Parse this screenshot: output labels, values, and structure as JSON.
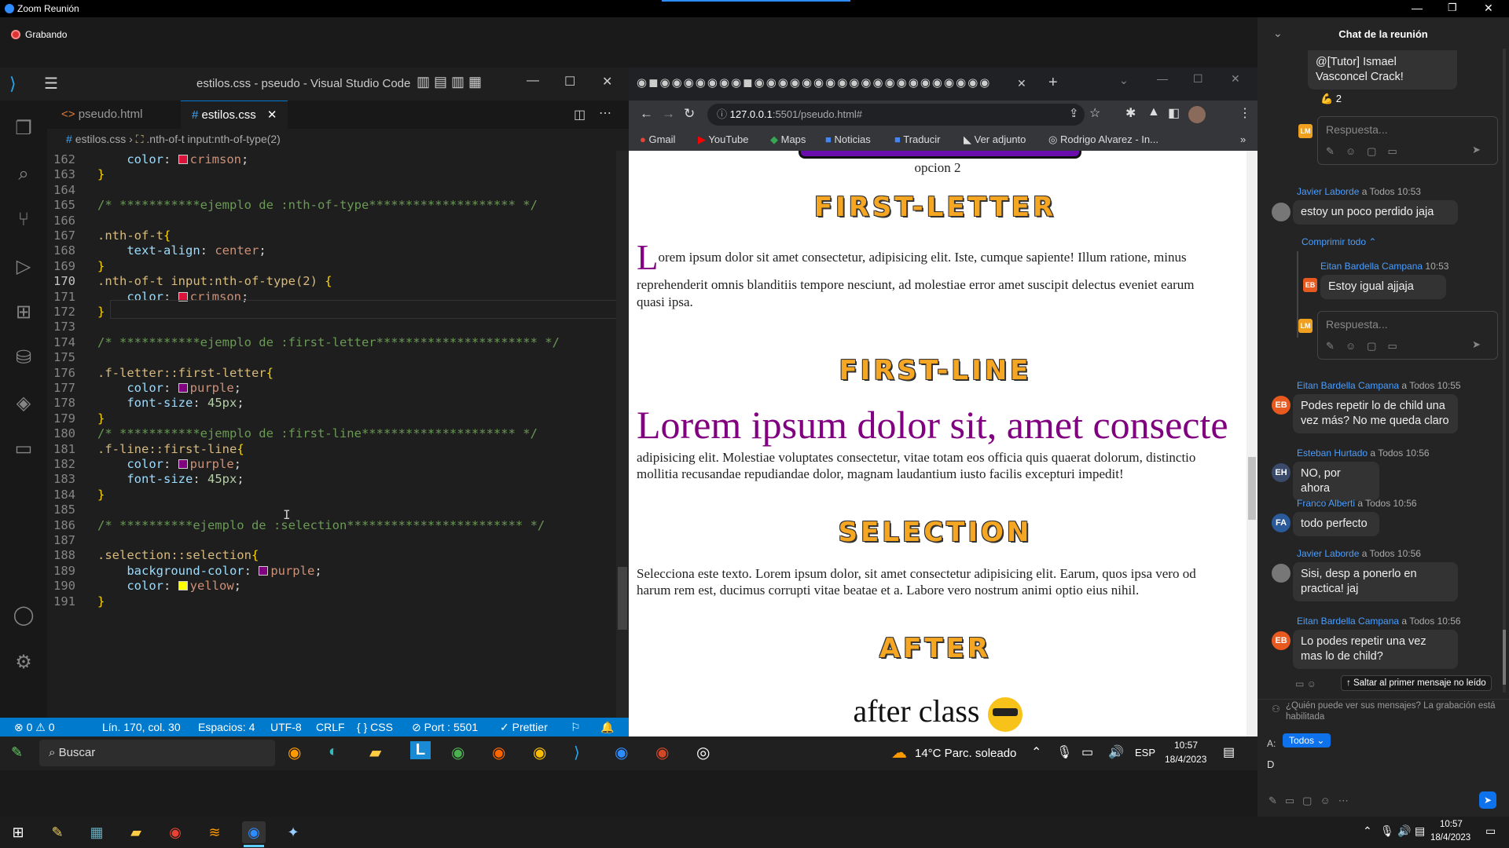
{
  "zoom": {
    "title": "Zoom Reunión",
    "recording": "Grabando"
  },
  "vscode": {
    "window_title": "estilos.css - pseudo - Visual Studio Code",
    "tabs": [
      {
        "label": "pseudo.html",
        "active": false
      },
      {
        "label": "estilos.css",
        "active": true
      }
    ],
    "breadcrumb": {
      "file": "estilos.css",
      "symbol": ".nth-of-t input:nth-of-type(2)"
    },
    "lines": [
      {
        "n": "162",
        "code": "    color: crimson;"
      },
      {
        "n": "163",
        "code": "}"
      },
      {
        "n": "164",
        "code": ""
      },
      {
        "n": "165",
        "code": "/* ***********ejemplo de :nth-of-type******************** */"
      },
      {
        "n": "166",
        "code": ""
      },
      {
        "n": "167",
        "code": ".nth-of-t{"
      },
      {
        "n": "168",
        "code": "    text-align: center;"
      },
      {
        "n": "169",
        "code": "}"
      },
      {
        "n": "170",
        "code": ".nth-of-t input:nth-of-type(2) {"
      },
      {
        "n": "171",
        "code": "    color: crimson;"
      },
      {
        "n": "172",
        "code": "}"
      },
      {
        "n": "173",
        "code": ""
      },
      {
        "n": "174",
        "code": "/* ***********ejemplo de :first-letter********************** */"
      },
      {
        "n": "175",
        "code": ""
      },
      {
        "n": "176",
        "code": ".f-letter::first-letter{"
      },
      {
        "n": "177",
        "code": "    color: purple;"
      },
      {
        "n": "178",
        "code": "    font-size: 45px;"
      },
      {
        "n": "179",
        "code": "}"
      },
      {
        "n": "180",
        "code": "/* ***********ejemplo de :first-line********************* */"
      },
      {
        "n": "181",
        "code": ".f-line::first-line{"
      },
      {
        "n": "182",
        "code": "    color: purple;"
      },
      {
        "n": "183",
        "code": "    font-size: 45px;"
      },
      {
        "n": "184",
        "code": "}"
      },
      {
        "n": "185",
        "code": ""
      },
      {
        "n": "186",
        "code": "/* **********ejemplo de :selection************************ */"
      },
      {
        "n": "187",
        "code": ""
      },
      {
        "n": "188",
        "code": ".selection::selection{"
      },
      {
        "n": "189",
        "code": "    background-color: purple;"
      },
      {
        "n": "190",
        "code": "    color: yellow;"
      },
      {
        "n": "191",
        "code": "}"
      }
    ],
    "status": {
      "errors": "⊗ 0 ⚠ 0",
      "position": "Lín. 170, col. 30",
      "spaces": "Espacios: 4",
      "encoding": "UTF-8",
      "eol": "CRLF",
      "lang": "{ } CSS",
      "port": "⊘ Port : 5501",
      "prettier": "✓ Prettier"
    },
    "colors": {
      "crimson": "#dc143c",
      "purple": "#800080",
      "yellow": "#ffff00"
    }
  },
  "browser": {
    "url_host": "127.0.0.1",
    "url_rest": ":5501/pseudo.html#",
    "bookmarks": [
      "Gmail",
      "YouTube",
      "Maps",
      "Noticias",
      "Traducir",
      "Ver adjunto",
      "Rodrigo Alvarez - In..."
    ],
    "page": {
      "opcion": "opcion 2",
      "h_first_letter": "FIRST-LETTER",
      "first_letter_cap": "L",
      "first_letter_line1": "orem ipsum dolor sit amet consectetur, adipisicing elit. Iste, cumque sapiente! Illum ratione, minus",
      "first_letter_line2": "reprehenderit omnis blanditiis tempore nesciunt, ad molestiae error amet suscipit delectus eveniet earum",
      "first_letter_line3": "quasi ipsa.",
      "h_first_line": "FIRST-LINE",
      "first_line_big": "Lorem ipsum dolor sit, amet consecte",
      "first_line_l2": "adipisicing elit. Molestiae voluptates consectetur, vitae totam eos officia quis quaerat dolorum, distinctio",
      "first_line_l3": "mollitia recusandae repudiandae dolor, magnam laudantium iusto facilis excepturi impedit!",
      "h_selection": "SELECTION",
      "selection_l1": "Selecciona este texto. Lorem ipsum dolor, sit amet consectetur adipisicing elit. Earum, quos ipsa vero od",
      "selection_l2": "harum rem est, ducimus corrupti vitae beatae et a. Labore vero nostrum animi optio eius nihil.",
      "h_after": "AFTER",
      "after_text": "after class"
    }
  },
  "inner_taskbar": {
    "search": "Buscar",
    "weather": "14°C  Parc. soleado",
    "lang": "ESP",
    "time": "10:57",
    "date": "18/4/2023"
  },
  "chat": {
    "title": "Chat de la reunión",
    "reply_placeholder": "Respuesta...",
    "top_msg": "@[Tutor] Ismael Vasconcel Crack!",
    "reaction": "💪 2",
    "collapse": "Comprimir todo ⌃",
    "to_label": "a Todos",
    "messages": [
      {
        "name": "Javier Laborde",
        "time": "10:53",
        "text": "estoy un poco perdido jaja",
        "initials": "",
        "color": "#666"
      },
      {
        "name": "Eitan Bardella Campana",
        "time": "10:53",
        "text": "Estoy igual ajjaja",
        "initials": "EB",
        "color": "#e8591f"
      },
      {
        "name": "Eitan Bardella Campana",
        "time": "10:55",
        "text": "Podes repetir lo de child una vez más? No me queda claro",
        "initials": "EB",
        "color": "#e8591f"
      },
      {
        "name": "Esteban Hurtado",
        "time": "10:56",
        "text": "NO, por ahora",
        "initials": "EH",
        "color": "#3a4a6a"
      },
      {
        "name": "Franco Alberti",
        "time": "10:56",
        "text": "todo perfecto",
        "initials": "FA",
        "color": "#2a5a9a"
      },
      {
        "name": "Javier Laborde",
        "time": "10:56",
        "text": "Sisi, desp a ponerlo en practica! jaj",
        "initials": "",
        "color": "#666"
      },
      {
        "name": "Eitan Bardella Campana",
        "time": "10:56",
        "text": "Lo podes repetir una vez mas lo de child?",
        "initials": "EB",
        "color": "#e8591f"
      }
    ],
    "jump_unread": "↑ Saltar al primer mensaje no leído",
    "who_sees": "¿Quién puede ver sus mensajes? La grabación está habilitada",
    "to": "A:",
    "to_value": "Todos ⌄",
    "draft": "D"
  },
  "windows_taskbar": {
    "time": "10:57",
    "date": "18/4/2023"
  }
}
